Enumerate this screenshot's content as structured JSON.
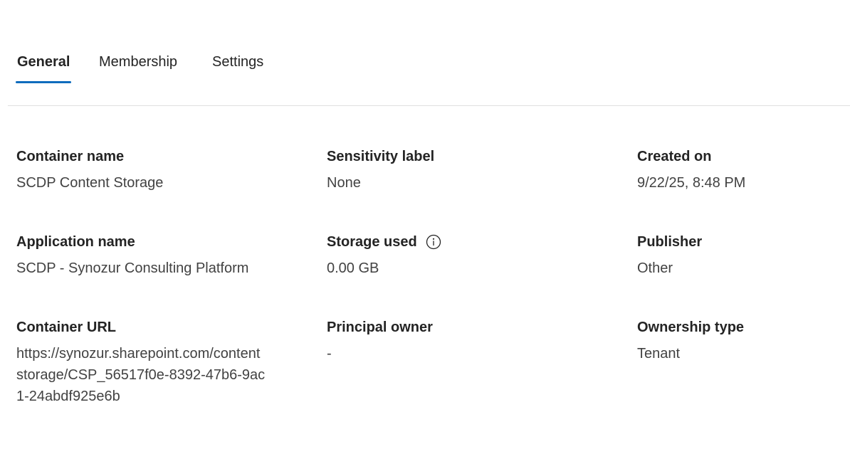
{
  "tabs": [
    {
      "label": "General",
      "active": true
    },
    {
      "label": "Membership",
      "active": false
    },
    {
      "label": "Settings",
      "active": false
    }
  ],
  "fields": {
    "container_name": {
      "label": "Container name",
      "value": "SCDP Content Storage"
    },
    "sensitivity_label": {
      "label": "Sensitivity label",
      "value": "None"
    },
    "created_on": {
      "label": "Created on",
      "value": "9/22/25, 8:48 PM"
    },
    "application_name": {
      "label": "Application name",
      "value": "SCDP - Synozur Consulting Platform"
    },
    "storage_used": {
      "label": "Storage used",
      "value": "0.00 GB",
      "icon": "info-icon"
    },
    "publisher": {
      "label": "Publisher",
      "value": "Other"
    },
    "container_url": {
      "label": "Container URL",
      "value": "https://synozur.sharepoint.com/contentstorage/CSP_56517f0e-8392-47b6-9ac1-24abdf925e6b"
    },
    "principal_owner": {
      "label": "Principal owner",
      "value": "-"
    },
    "ownership_type": {
      "label": "Ownership type",
      "value": "Tenant"
    }
  },
  "colors": {
    "accent": "#0f6cbd",
    "text_primary": "#242424",
    "text_secondary": "#424242",
    "divider": "#e0e0e0"
  }
}
